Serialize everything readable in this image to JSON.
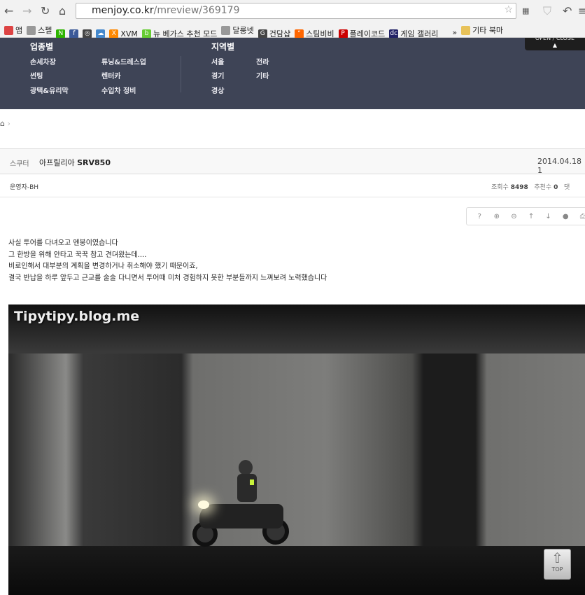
{
  "browser": {
    "url_host": "menjoy.co.kr",
    "url_path": "/mreview/369179",
    "bookmarks": [
      {
        "label": "앱",
        "color": "#d44"
      },
      {
        "label": "스펠",
        "color": "#999"
      },
      {
        "label": "",
        "color": "#2db400",
        "glyph": "N"
      },
      {
        "label": "",
        "color": "#3b5998",
        "glyph": "f"
      },
      {
        "label": "",
        "color": "#444",
        "glyph": "◎"
      },
      {
        "label": "",
        "color": "#48c",
        "glyph": "☁"
      },
      {
        "label": "XVM",
        "color": "#f80",
        "glyph": "X"
      },
      {
        "label": "뉴 베가스 추천 모드",
        "color": "#6c3",
        "glyph": "b"
      },
      {
        "label": "달룽넷",
        "color": "#999"
      },
      {
        "label": "건담샵",
        "color": "#444",
        "glyph": "G"
      },
      {
        "label": "스팀비비",
        "color": "#f60",
        "glyph": "“"
      },
      {
        "label": "플레이코드",
        "color": "#c00",
        "glyph": "P"
      },
      {
        "label": "게임 갤러리",
        "color": "#226",
        "glyph": "dc"
      }
    ],
    "overflow": "»",
    "other_bookmarks": "기타 북마"
  },
  "topnav": {
    "cat_heading": "업종별",
    "cat_col1": [
      "손세차장",
      "썬팅",
      "광택&유리막"
    ],
    "cat_col2": [
      "튜닝&드레스업",
      "렌터카",
      "수입차 정비"
    ],
    "region_heading": "지역별",
    "region_col1": [
      "서울",
      "경기",
      "경상"
    ],
    "region_col2": [
      "전라",
      "기타"
    ],
    "toggle_label": "OPEN / CLOSE"
  },
  "post": {
    "category": "스쿠터",
    "title_prefix": "아프릴리아",
    "title_model": "SRV850",
    "date": "2014.04.18 1",
    "author": "운영자-BH",
    "views_label": "조회수",
    "views": "8498",
    "recs_label": "추천수",
    "recs": "0",
    "comments_label": "댓",
    "tools": [
      "?",
      "⊕",
      "⊖",
      "↑",
      "↓",
      "●",
      "⎙"
    ],
    "body": [
      "사실 투어를 다녀오고 멘붕이였습니다",
      "그 한방을 위해 안타고 꾹꾹 참고 견뎌왔는데....",
      "비로인해서 대부분의 계획을 변경하거나 취소해야 했기 때문이죠,",
      "결국 반납을 하루 앞두고 근교를 술술 다니면서 투어때 미처 경험하지 못한 부분들까지 느껴보려 노력했습니다"
    ],
    "photo_watermark": "Tipytipy.blog.me"
  },
  "top_button": "TOP"
}
